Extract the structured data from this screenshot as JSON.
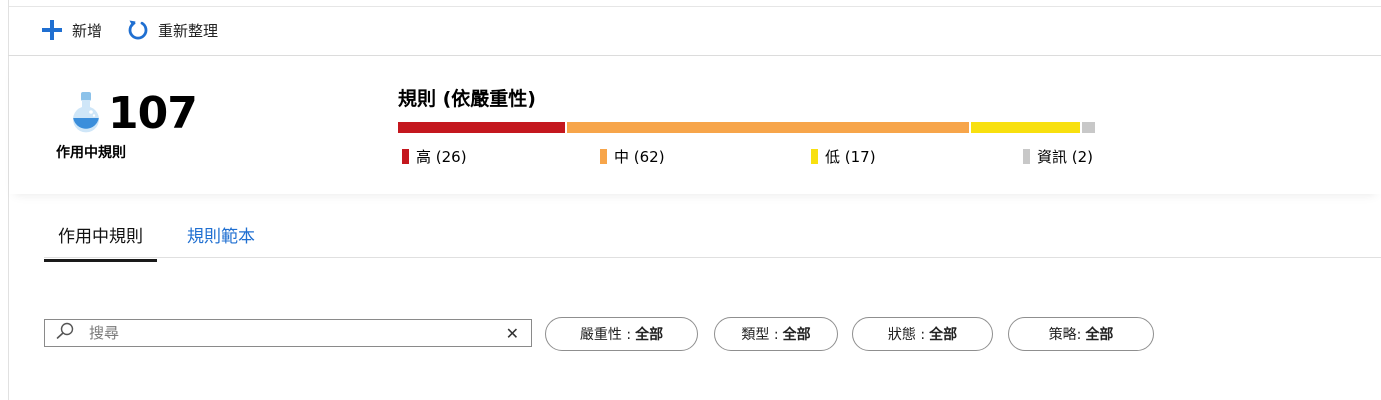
{
  "toolbar": {
    "add_label": "新增",
    "refresh_label": "重新整理"
  },
  "summary": {
    "active_count": "107",
    "active_label": "作用中規則"
  },
  "severity": {
    "title": "規則 (依嚴重性)",
    "items": [
      {
        "label": "高 (26)",
        "count": 26,
        "color": "#c4171e"
      },
      {
        "label": "中 (62)",
        "count": 62,
        "color": "#f7a54a"
      },
      {
        "label": "低 (17)",
        "count": 17,
        "color": "#f8e00f"
      },
      {
        "label": "資訊 (2)",
        "count": 2,
        "color": "#c8c8c8"
      }
    ]
  },
  "tabs": [
    {
      "label": "作用中規則",
      "active": true
    },
    {
      "label": "規則範本",
      "active": false
    }
  ],
  "search": {
    "placeholder": "搜尋"
  },
  "filters": [
    {
      "name": "嚴重性 :",
      "value": "全部"
    },
    {
      "name": "類型 :",
      "value": "全部"
    },
    {
      "name": "狀態 :",
      "value": "全部"
    },
    {
      "name": "策略:",
      "value": "全部"
    }
  ],
  "icons": {
    "add": "plus-icon",
    "refresh": "refresh-icon",
    "flask": "flask-icon",
    "search": "search-icon",
    "clear": "close-icon"
  },
  "colors": {
    "accent": "#1f6fd1"
  }
}
